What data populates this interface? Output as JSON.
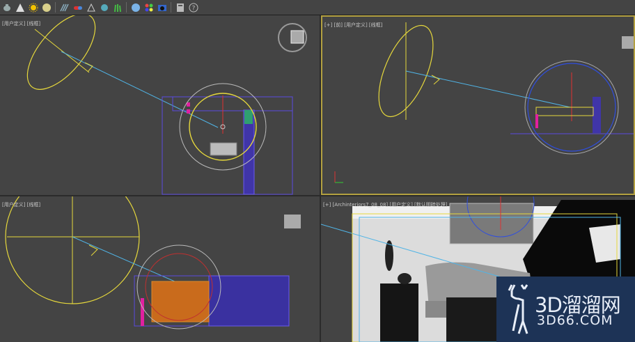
{
  "toolbar": {
    "icons": [
      "teapot-icon",
      "cone-icon",
      "sun-icon",
      "sphere-icon",
      "particles-icon",
      "capsule-icon",
      "lamp-icon",
      "snowflake-icon",
      "grass-icon",
      "material-ball-icon",
      "color-dots-icon",
      "render-teapot-icon",
      "panel-icon",
      "help-icon"
    ],
    "help_symbol": "?"
  },
  "viewports": {
    "top_left": {
      "label": "[用户定义] [线框]"
    },
    "top_right": {
      "label": "[+] [前] [用户定义] [线框]"
    },
    "bottom_left": {
      "label": "[用户定义] [线框]"
    },
    "bottom_right": {
      "label": "[+] [Archinteriors7_08_08] [用户定义] [默认明暗处理]"
    }
  },
  "watermark": {
    "title": "3D溜溜网",
    "url": "3D66.COM"
  },
  "colors": {
    "viewport_bg": "#444444",
    "active_border": "#b3a040",
    "light_yellow": "#e6d83c",
    "target_blue": "#50b4e6",
    "geometry_purple": "#5a4ae0",
    "watermark_bg": "#1d3356"
  }
}
